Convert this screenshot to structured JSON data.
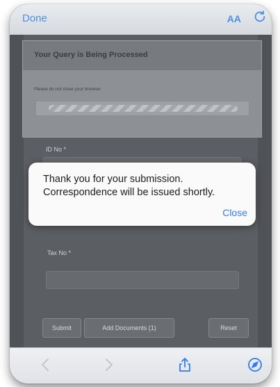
{
  "safari": {
    "done_label": "Done",
    "aa_label": "AA"
  },
  "processing_modal": {
    "title": "Your Query is Being Processed",
    "subtitle": "Please do not close your browser"
  },
  "form": {
    "id_label": "ID No *",
    "tax_label": "Tax No *",
    "submit_label": "Submit",
    "add_documents_label": "Add Documents (1)",
    "reset_label": "Reset"
  },
  "alert": {
    "line1": "Thank you for your submission.",
    "line2": "Correspondence will be issued shortly.",
    "close_label": "Close"
  },
  "colors": {
    "ios_blue": "#2f7cf6",
    "overlay": "#4a4d52"
  },
  "icons": [
    "reload-icon",
    "back-icon",
    "forward-icon",
    "share-icon",
    "compass-icon"
  ]
}
